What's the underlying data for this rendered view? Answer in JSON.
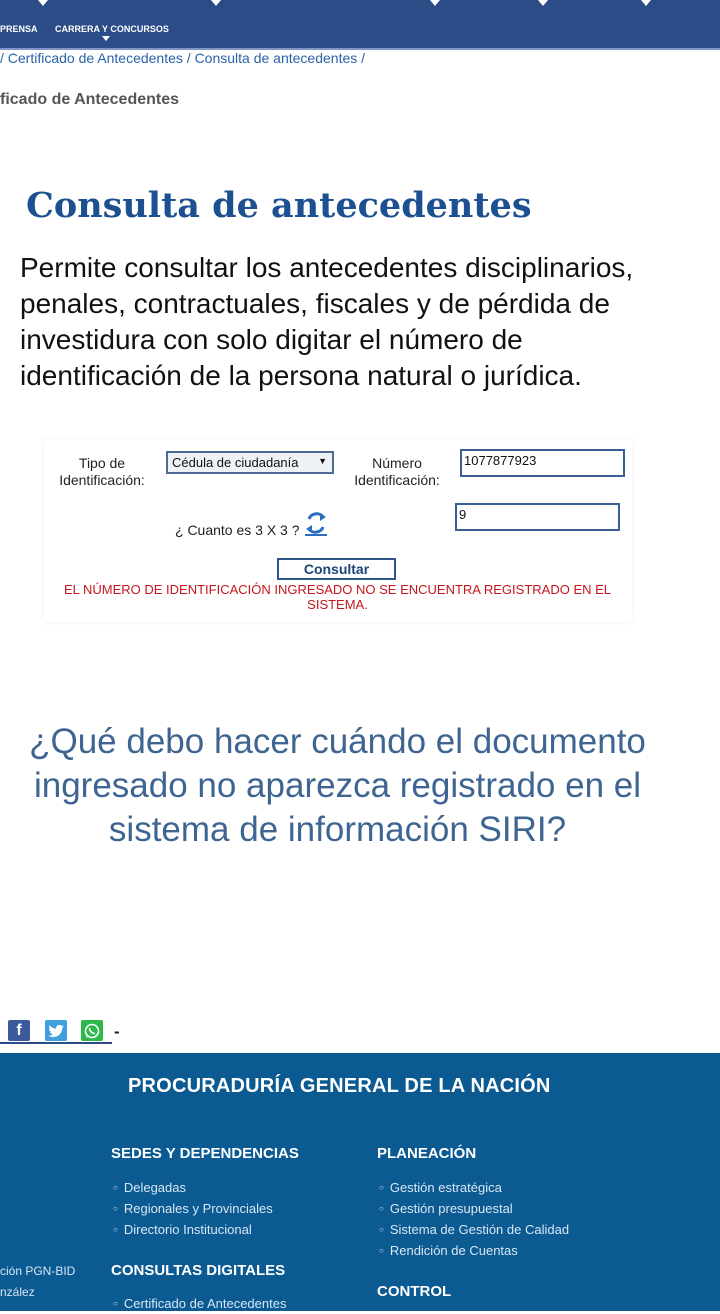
{
  "nav": {
    "items": [
      "PRENSA",
      "CARRERA Y CONCURSOS"
    ]
  },
  "breadcrumb": "/ Certificado de Antecedentes / Consulta de antecedentes /",
  "section_title": "ficado de Antecedentes",
  "page_heading": "Consulta de antecedentes",
  "intro": "Permite consultar los antecedentes disciplinarios, penales, contractuales, fiscales y de pérdida de investidura con solo digitar el número de identificación de la persona natural o jurídica.",
  "form": {
    "tipo_label_1": "Tipo de",
    "tipo_label_2": "Identificación:",
    "tipo_value": "Cédula de ciudadanía",
    "numero_label_1": "Número",
    "numero_label_2": "Identificación:",
    "numero_value": "1077877923",
    "captcha_question": "¿ Cuanto es 3 X 3 ?",
    "captcha_value": "9",
    "submit_label": "Consultar",
    "error": "EL NÚMERO DE IDENTIFICACIÓN INGRESADO NO SE ENCUENTRA REGISTRADO EN EL SISTEMA."
  },
  "faq_title": "¿Qué debo hacer cuándo el documento ingresado no aparezca registrado en el sistema de información SIRI?",
  "share": {
    "facebook_glyph": "f",
    "dash": "-"
  },
  "footer": {
    "org": "PROCURADURÍA GENERAL DE LA NACIÓN",
    "sedes_title": "SEDES Y DEPENDENCIAS",
    "sedes_items": [
      "Delegadas",
      "Regionales y Provinciales",
      "Directorio Institucional"
    ],
    "planeacion_title": "PLANEACIÓN",
    "planeacion_items": [
      "Gestión estratégica",
      "Gestión presupuestal",
      "Sistema de Gestión de Calidad",
      "Rendición de Cuentas"
    ],
    "consultas_title": "CONSULTAS DIGITALES",
    "consultas_items": [
      "Certificado de Antecedentes"
    ],
    "control_title": "CONTROL",
    "side_1": "ción PGN-BID",
    "side_2": "nzález"
  },
  "colors": {
    "nav_bg": "#2c4c87",
    "heading": "#1d5090",
    "error": "#c4161c",
    "footer_bg": "#0b5a91",
    "facebook": "#3b5a9a",
    "twitter": "#3ea1dc",
    "whatsapp": "#2fb84a"
  }
}
